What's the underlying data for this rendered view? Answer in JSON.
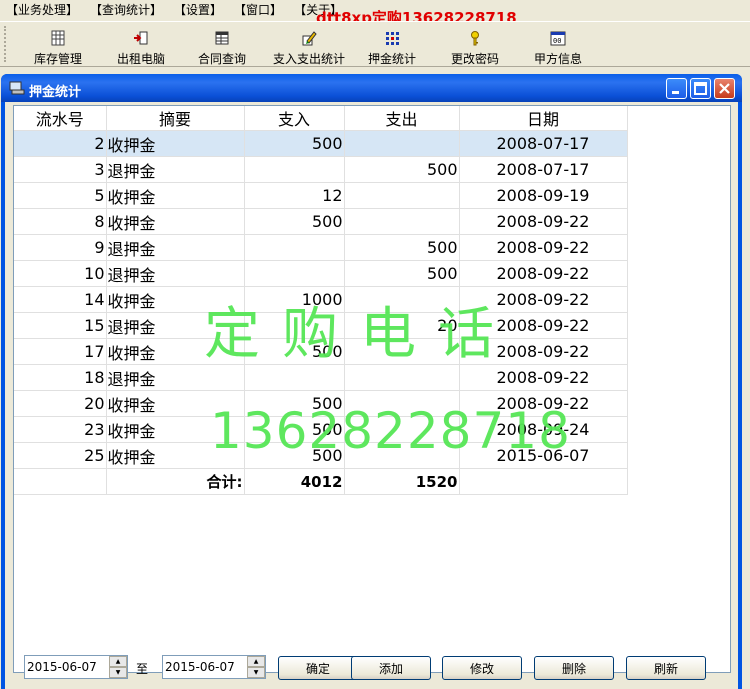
{
  "menu": [
    "【业务处理】",
    "【查询统计】",
    "【设置】",
    "【窗口】",
    "【关于】"
  ],
  "overlay_title": "dtt8xp定购13628228718",
  "toolbar": [
    {
      "label": "库存管理",
      "icon": "grid-icon"
    },
    {
      "label": "出租电脑",
      "icon": "export-icon"
    },
    {
      "label": "合同查询",
      "icon": "table-icon"
    },
    {
      "label": "支入支出统计",
      "icon": "pencil-icon"
    },
    {
      "label": "押金统计",
      "icon": "dots-icon"
    },
    {
      "label": "更改密码",
      "icon": "key-icon"
    },
    {
      "label": "甲方信息",
      "icon": "calendar-icon"
    }
  ],
  "window": {
    "title": "押金统计"
  },
  "table": {
    "columns": [
      "流水号",
      "摘要",
      "支入",
      "支出",
      "日期"
    ],
    "rows": [
      {
        "id": "2",
        "summary": "收押金",
        "in": "500",
        "out": "",
        "date": "2008-07-17"
      },
      {
        "id": "3",
        "summary": "退押金",
        "in": "",
        "out": "500",
        "date": "2008-07-17"
      },
      {
        "id": "5",
        "summary": "收押金",
        "in": "12",
        "out": "",
        "date": "2008-09-19"
      },
      {
        "id": "8",
        "summary": "收押金",
        "in": "500",
        "out": "",
        "date": "2008-09-22"
      },
      {
        "id": "9",
        "summary": "退押金",
        "in": "",
        "out": "500",
        "date": "2008-09-22"
      },
      {
        "id": "10",
        "summary": "退押金",
        "in": "",
        "out": "500",
        "date": "2008-09-22"
      },
      {
        "id": "14",
        "summary": "收押金",
        "in": "1000",
        "out": "",
        "date": "2008-09-22"
      },
      {
        "id": "15",
        "summary": "退押金",
        "in": "",
        "out": "20",
        "date": "2008-09-22"
      },
      {
        "id": "17",
        "summary": "收押金",
        "in": "500",
        "out": "",
        "date": "2008-09-22"
      },
      {
        "id": "18",
        "summary": "退押金",
        "in": "",
        "out": "",
        "date": "2008-09-22"
      },
      {
        "id": "20",
        "summary": "收押金",
        "in": "500",
        "out": "",
        "date": "2008-09-22"
      },
      {
        "id": "23",
        "summary": "收押金",
        "in": "500",
        "out": "",
        "date": "2008-09-24"
      },
      {
        "id": "25",
        "summary": "收押金",
        "in": "500",
        "out": "",
        "date": "2015-06-07"
      }
    ],
    "total": {
      "label": "合计:",
      "in": "4012",
      "out": "1520"
    }
  },
  "watermark": {
    "line1": "定购电话",
    "line2": "13628228718"
  },
  "bottom": {
    "date_from": "2015-06-07",
    "to_label": "至",
    "date_to": "2015-06-07",
    "buttons": [
      "确定",
      "添加",
      "修改",
      "删除",
      "刷新"
    ]
  }
}
